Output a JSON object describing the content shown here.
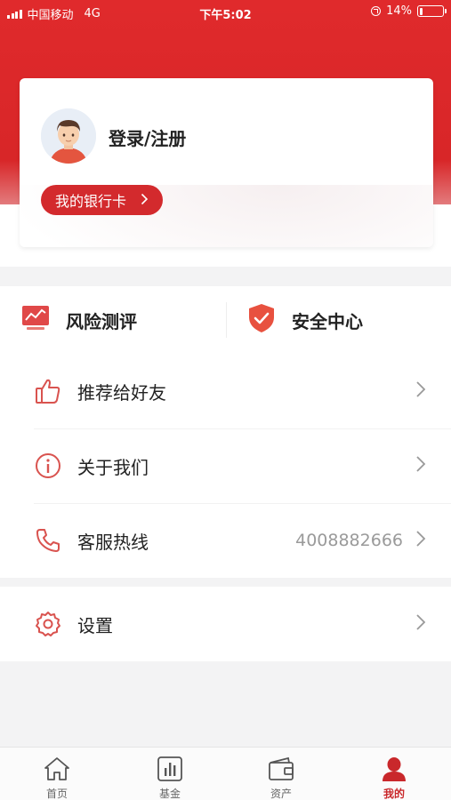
{
  "status_bar": {
    "carrier": "中国移动",
    "network": "4G",
    "time": "下午5:02",
    "battery_text": "14%",
    "battery_level": 0.14
  },
  "profile_card": {
    "login_label": "登录/注册",
    "bank_card_label": "我的银行卡",
    "bank_card_chevron": ">"
  },
  "quick_actions": [
    {
      "label": "风险测评",
      "icon": "risk-assessment-icon"
    },
    {
      "label": "安全中心",
      "icon": "shield-check-icon"
    }
  ],
  "menu": {
    "items": [
      {
        "label": "推荐给好友",
        "icon": "thumbs-up-icon",
        "value": ""
      },
      {
        "label": "关于我们",
        "icon": "info-icon",
        "value": ""
      },
      {
        "label": "客服热线",
        "icon": "phone-icon",
        "value": "4008882666"
      }
    ],
    "settings": {
      "label": "设置",
      "icon": "gear-icon"
    }
  },
  "tabbar": {
    "tabs": [
      {
        "label": "首页",
        "icon": "home-icon",
        "active": false
      },
      {
        "label": "基金",
        "icon": "chart-bar-icon",
        "active": false
      },
      {
        "label": "资产",
        "icon": "wallet-icon",
        "active": false
      },
      {
        "label": "我的",
        "icon": "person-icon",
        "active": true
      }
    ]
  },
  "colors": {
    "brand_red": "#d32a2d",
    "icon_red": "#d9534f",
    "background": "#f3f3f4"
  }
}
